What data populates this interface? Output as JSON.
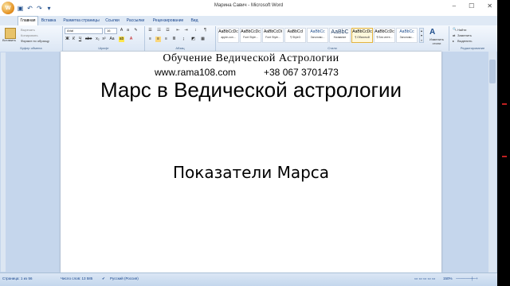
{
  "window": {
    "title": "Марина Савич - Microsoft Word",
    "controls": [
      "–",
      "☐",
      "✕"
    ]
  },
  "tabs": [
    "Главная",
    "Вставка",
    "Разметка страницы",
    "Ссылки",
    "Рассылки",
    "Рецензирование",
    "Вид"
  ],
  "ribbon": {
    "clipboard": {
      "paste": "Вставить",
      "cut": "Вырезать",
      "copy": "Копировать",
      "format_painter": "Формат по образцу",
      "label": "Буфер обмена"
    },
    "font": {
      "name": "Arial",
      "size": "16",
      "label": "Шрифт"
    },
    "paragraph": {
      "label": "Абзац"
    },
    "styles": {
      "tiles": [
        {
          "sample": "AaBbCcDc",
          "name": "apple-con..."
        },
        {
          "sample": "AaBbCcDc",
          "name": "Font Style..."
        },
        {
          "sample": "AaBbCcDi",
          "name": "Font Style..."
        },
        {
          "sample": "AaBbCcI",
          "name": "¶ Style3"
        },
        {
          "sample": "AaBbCc",
          "name": "Заголово..."
        },
        {
          "sample": "AaBbC",
          "name": "Название"
        },
        {
          "sample": "AaBbCcDc",
          "name": "¶ Обычный"
        },
        {
          "sample": "AaBbCcDc",
          "name": "¶ Без инте..."
        },
        {
          "sample": "AaBbCc",
          "name": "Заголово..."
        }
      ],
      "change": "Изменить стили",
      "label": "Стили"
    },
    "editing": {
      "find": "Найти",
      "replace": "Заменить",
      "select": "Выделить",
      "label": "Редактирование"
    }
  },
  "document": {
    "line1": "Обучение   Ведической   Астрологии",
    "site": "www.rama108.com",
    "phone": "+38 067 3701473",
    "title": "Марс в Ведической астрологии",
    "subtitle": "Показатели Марса"
  },
  "status": {
    "page": "Страница: 1 из 56",
    "words": "Число слов: 13 585",
    "language": "Русский (Россия)",
    "zoom": "150%"
  }
}
